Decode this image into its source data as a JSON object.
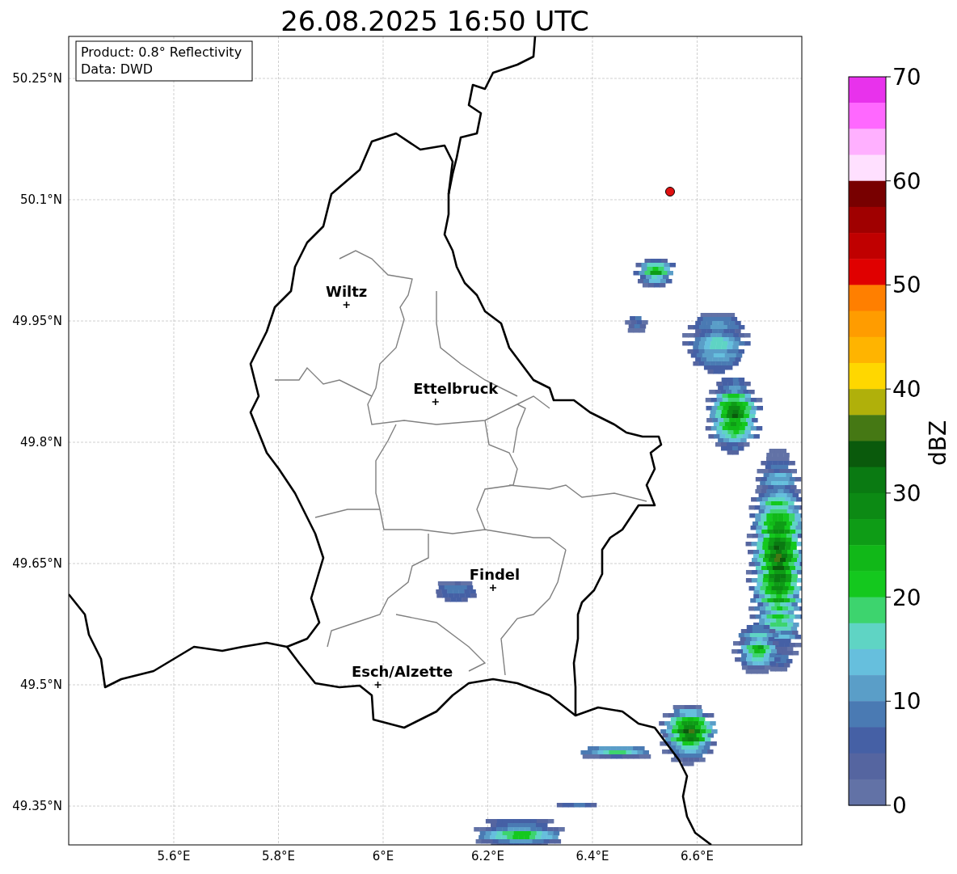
{
  "title": "26.08.2025 16:50 UTC",
  "info_box": [
    "Product: 0.8° Reflectivity",
    "Data: DWD"
  ],
  "y_ticks": [
    "50.25°N",
    "50.1°N",
    "49.95°N",
    "49.8°N",
    "49.65°N",
    "49.5°N",
    "49.35°N"
  ],
  "x_ticks": [
    "5.6°E",
    "5.8°E",
    "6°E",
    "6.2°E",
    "6.4°E",
    "6.6°E"
  ],
  "cities": [
    {
      "name": "Wiltz"
    },
    {
      "name": "Ettelbruck"
    },
    {
      "name": "Findel"
    },
    {
      "name": "Esch/Alzette"
    }
  ],
  "colorbar": {
    "label": "dBZ",
    "ticks": [
      "70",
      "60",
      "50",
      "40",
      "30",
      "20",
      "10",
      "0"
    ],
    "bins": [
      {
        "color": "#e832ec"
      },
      {
        "color": "#ff68ff"
      },
      {
        "color": "#ffb0ff"
      },
      {
        "color": "#ffe0ff"
      },
      {
        "color": "#780000"
      },
      {
        "color": "#a00000"
      },
      {
        "color": "#c00000"
      },
      {
        "color": "#e00000"
      },
      {
        "color": "#ff7f00"
      },
      {
        "color": "#ff9c00"
      },
      {
        "color": "#ffb400"
      },
      {
        "color": "#ffd700"
      },
      {
        "color": "#b0b00a"
      },
      {
        "color": "#457814"
      },
      {
        "color": "#0a5a0c"
      },
      {
        "color": "#0a7a12"
      },
      {
        "color": "#0c8a14"
      },
      {
        "color": "#0e9c16"
      },
      {
        "color": "#11b818"
      },
      {
        "color": "#14c81e"
      },
      {
        "color": "#3dd46e"
      },
      {
        "color": "#5fd4c4"
      },
      {
        "color": "#66bfdd"
      },
      {
        "color": "#5a9ec8"
      },
      {
        "color": "#4a7ab3"
      },
      {
        "color": "#4560a5"
      },
      {
        "color": "#5565a0"
      },
      {
        "color": "#6272a6"
      }
    ]
  }
}
